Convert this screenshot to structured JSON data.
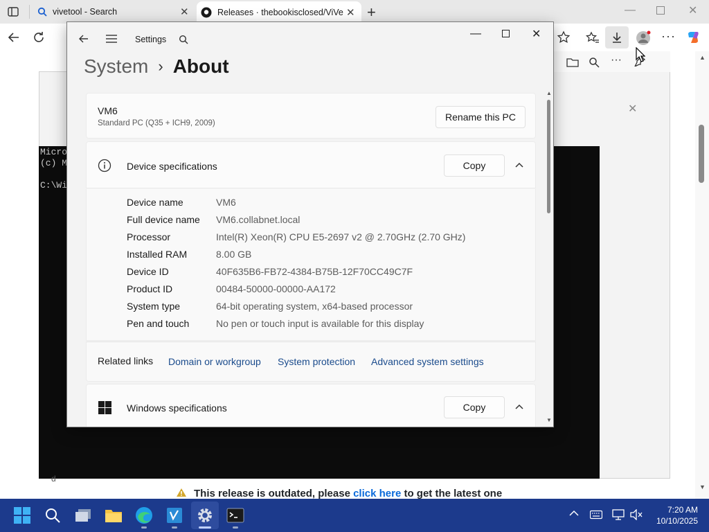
{
  "browser": {
    "tabs": [
      {
        "label": "vivetool - Search"
      },
      {
        "label": "Releases · thebookisclosed/ViVe"
      }
    ]
  },
  "terminal": {
    "lines": [
      "Micro",
      "(c) M",
      "",
      "C:\\Wi"
    ]
  },
  "web": {
    "release_text_1": "This release is outdated, please ",
    "release_link": "click here",
    "release_text_2": " to get the latest one",
    "left_char": "d"
  },
  "settings": {
    "app_title": "Settings",
    "breadcrumb_parent": "System",
    "breadcrumb_separator": "›",
    "breadcrumb_current": "About",
    "pc_name": "VM6",
    "pc_model": "Standard PC (Q35 + ICH9, 2009)",
    "rename_button": "Rename this PC",
    "device_specs": {
      "title": "Device specifications",
      "copy": "Copy",
      "rows": [
        {
          "label": "Device name",
          "value": "VM6"
        },
        {
          "label": "Full device name",
          "value": "VM6.collabnet.local"
        },
        {
          "label": "Processor",
          "value": "Intel(R) Xeon(R) CPU E5-2697 v2 @ 2.70GHz (2.70 GHz)"
        },
        {
          "label": "Installed RAM",
          "value": "8.00 GB"
        },
        {
          "label": "Device ID",
          "value": "40F635B6-FB72-4384-B75B-12F70CC49C7F"
        },
        {
          "label": "Product ID",
          "value": "00484-50000-00000-AA172"
        },
        {
          "label": "System type",
          "value": "64-bit operating system, x64-based processor"
        },
        {
          "label": "Pen and touch",
          "value": "No pen or touch input is available for this display"
        }
      ]
    },
    "related": {
      "title": "Related links",
      "links": [
        "Domain or workgroup",
        "System protection",
        "Advanced system settings"
      ]
    },
    "windows_specs": {
      "title": "Windows specifications",
      "copy": "Copy"
    }
  },
  "taskbar": {
    "time": "7:20 AM",
    "date": "10/10/2025"
  }
}
